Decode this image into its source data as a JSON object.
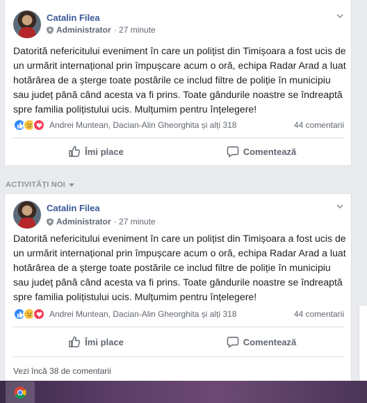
{
  "posts": [
    {
      "author": "Catalin Filea",
      "role": "Administrator",
      "time": "· 27 minute",
      "text": "Datorită nefericitului eveniment în care un polițist din Timișoara a fost ucis de un urmărit internațional prin împușcare acum o oră, echipa Radar Arad a luat hotărârea de a șterge toate postările ce includ filtre de poliție în municipiu sau județ până când acesta va fi prins. Toate gândurile noastre se îndreaptă spre familia polițistului ucis. Mulțumim pentru înțelegere!",
      "reactors": "Andrei Muntean, Dacian-Alin Gheorghita și alți 318",
      "comments": "44 comentarii",
      "like_label": "Îmi place",
      "comment_label": "Comentează"
    },
    {
      "author": "Catalin Filea",
      "role": "Administrator",
      "time": "· 27 minute",
      "text": "Datorită nefericitului eveniment în care un polițist din Timișoara a fost ucis de un urmărit internațional prin împușcare acum o oră, echipa Radar Arad a luat hotărârea de a șterge toate postările ce includ filtre de poliție în municipiu sau județ până când acesta va fi prins. Toate gândurile noastre se îndreaptă spre familia polițistului ucis. Mulțumim pentru înțelegere!",
      "reactors": "Andrei Muntean, Dacian-Alin Gheorghita și alți 318",
      "comments": "44 comentarii",
      "like_label": "Îmi place",
      "comment_label": "Comentează",
      "more_comments": "Vezi încă 38 de comentarii"
    }
  ],
  "section_label": "ACTIVITĂȚI NOI",
  "colors": {
    "link": "#385898",
    "secondary": "#606770",
    "like": "#2d88ff",
    "sad": "#f7c240",
    "love": "#f33e58"
  },
  "icons": [
    "shield-icon",
    "chevron-down-icon",
    "like-reaction-icon",
    "sad-reaction-icon",
    "love-reaction-icon",
    "thumbs-up-icon",
    "comment-icon",
    "chrome-icon"
  ]
}
